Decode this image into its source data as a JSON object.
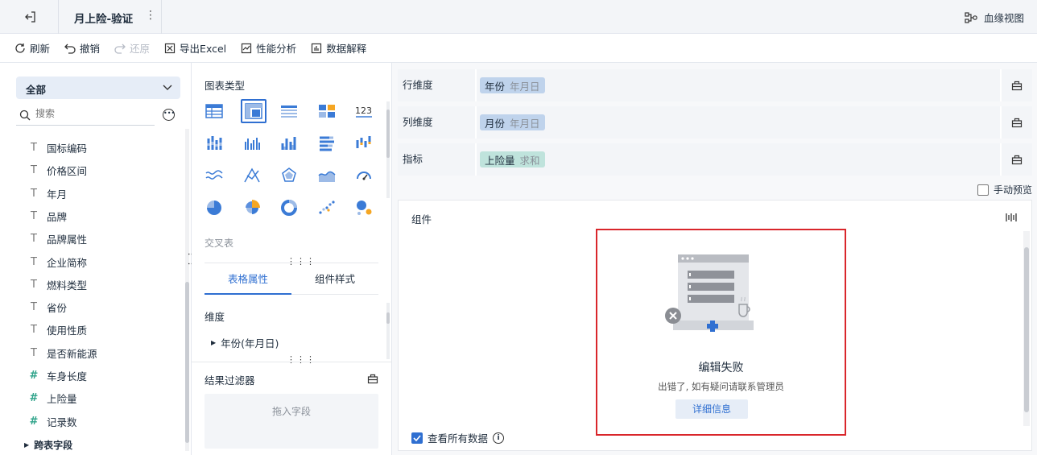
{
  "header": {
    "title": "月上险-验证",
    "lineage_label": "血缘视图"
  },
  "toolbar": {
    "refresh": "刷新",
    "undo": "撤销",
    "redo": "还原",
    "export": "导出Excel",
    "perf": "性能分析",
    "explain": "数据解释"
  },
  "left": {
    "select_value": "全部",
    "search_placeholder": "搜索",
    "fields": [
      {
        "type": "text",
        "label": "国标编码"
      },
      {
        "type": "text",
        "label": "价格区间"
      },
      {
        "type": "text",
        "label": "年月"
      },
      {
        "type": "text",
        "label": "品牌"
      },
      {
        "type": "text",
        "label": "品牌属性"
      },
      {
        "type": "text",
        "label": "企业简称"
      },
      {
        "type": "text",
        "label": "燃料类型"
      },
      {
        "type": "text",
        "label": "省份"
      },
      {
        "type": "text",
        "label": "使用性质"
      },
      {
        "type": "text",
        "label": "是否新能源"
      },
      {
        "type": "number",
        "label": "车身长度"
      },
      {
        "type": "number",
        "label": "上险量"
      },
      {
        "type": "count",
        "label": "记录数"
      }
    ],
    "cross_fields": "跨表字段"
  },
  "mid": {
    "chart_type_label": "图表类型",
    "cross_table_label": "交叉表",
    "tabs": [
      "表格属性",
      "组件样式"
    ],
    "dimension_label": "维度",
    "dimension_item": "年份(年月日)",
    "filter_label": "结果过滤器",
    "drop_hint": "拖入字段"
  },
  "right": {
    "rows": [
      {
        "label": "行维度",
        "field": "年份",
        "sub": "年月日",
        "color": "blue"
      },
      {
        "label": "列维度",
        "field": "月份",
        "sub": "年月日",
        "color": "blue"
      },
      {
        "label": "指标",
        "field": "上险量",
        "sub": "求和",
        "color": "green"
      }
    ],
    "manual_preview": "手动预览",
    "component_label": "组件",
    "error_title": "编辑失败",
    "error_desc": "出错了, 如有疑问请联系管理员",
    "detail_btn": "详细信息",
    "view_all": "查看所有数据"
  },
  "colors": {
    "accent": "#2f6fd1",
    "error_border": "#d9262b"
  }
}
